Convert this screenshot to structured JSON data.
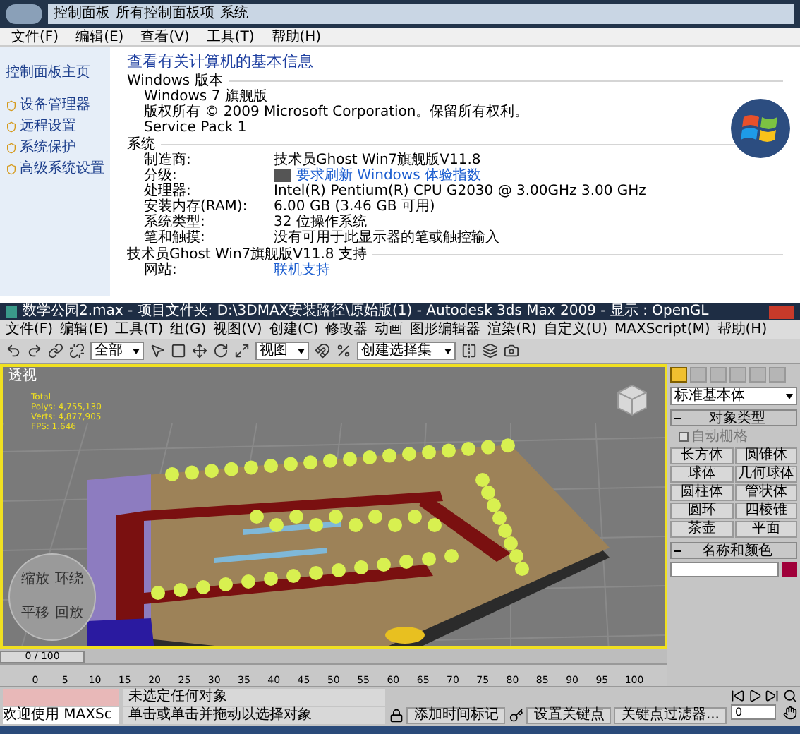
{
  "system_window": {
    "breadcrumb": [
      "控制面板",
      "所有控制面板项",
      "系统"
    ],
    "menu": [
      "文件(F)",
      "编辑(E)",
      "查看(V)",
      "工具(T)",
      "帮助(H)"
    ],
    "sidebar": [
      {
        "label": "控制面板主页",
        "kind": "home"
      },
      {
        "label": "设备管理器",
        "kind": "shield"
      },
      {
        "label": "远程设置",
        "kind": "shield"
      },
      {
        "label": "系统保护",
        "kind": "shield"
      },
      {
        "label": "高级系统设置",
        "kind": "shield"
      }
    ],
    "title": "查看有关计算机的基本信息",
    "sections": [
      {
        "heading": "Windows 版本",
        "rows": [
          {
            "value": "Windows 7 旗舰版",
            "kind": "text"
          },
          {
            "value": "版权所有 © 2009 Microsoft Corporation。保留所有权利。",
            "kind": "text"
          },
          {
            "value": "Service Pack 1",
            "kind": "text"
          }
        ]
      },
      {
        "heading": "系统",
        "rows": [
          {
            "label": "制造商:",
            "value": "技术员Ghost Win7旗舰版V11.8",
            "kind": "text"
          },
          {
            "label": "分级:",
            "value": "要求刷新 Windows 体验指数",
            "kind": "rating"
          },
          {
            "label": "处理器:",
            "value": "Intel(R) Pentium(R) CPU G2030 @ 3.00GHz   3.00 GHz",
            "kind": "text"
          },
          {
            "label": "安装内存(RAM):",
            "value": "6.00 GB (3.46 GB 可用)",
            "kind": "text"
          },
          {
            "label": "系统类型:",
            "value": "32 位操作系统",
            "kind": "text"
          },
          {
            "label": "笔和触摸:",
            "value": "没有可用于此显示器的笔或触控输入",
            "kind": "text"
          }
        ]
      },
      {
        "heading": "技术员Ghost Win7旗舰版V11.8 支持",
        "rows": [
          {
            "label": "网站:",
            "value": "联机支持",
            "kind": "link"
          }
        ]
      }
    ]
  },
  "max_window": {
    "title": "数学公园2.max - 项目文件夹: D:\\3DMAX安装路径\\原始版(1) - Autodesk 3ds Max 2009 - 显示 : OpenGL",
    "menu": [
      "文件(F)",
      "编辑(E)",
      "工具(T)",
      "组(G)",
      "视图(V)",
      "创建(C)",
      "修改器",
      "动画",
      "图形编辑器",
      "渲染(R)",
      "自定义(U)",
      "MAXScript(M)",
      "帮助(H)"
    ],
    "toolbar": {
      "selection_filter": "全部",
      "reference_coords": "视图",
      "selection_set": "创建选择集"
    },
    "viewport": {
      "label": "透视",
      "stats": [
        "Total",
        "Polys: 4,755,130",
        "Verts: 4,877,905",
        "FPS: 1.646"
      ],
      "wheel_labels": [
        "缩放",
        "环绕",
        "平移",
        "回放"
      ]
    },
    "command_panel": {
      "tabs": [
        {
          "selected": true
        },
        {
          "selected": false
        },
        {
          "selected": false
        },
        {
          "selected": false
        },
        {
          "selected": false
        },
        {
          "selected": false
        }
      ],
      "category": "标准基本体",
      "object_type": {
        "title": "对象类型",
        "expanded": true,
        "autogrid": {
          "label": "自动栅格",
          "checked": false
        },
        "buttons": [
          "长方体",
          "圆锥体",
          "球体",
          "几何球体",
          "圆柱体",
          "管状体",
          "圆环",
          "四棱锥",
          "茶壶",
          "平面"
        ]
      },
      "name_color": {
        "title": "名称和颜色",
        "expanded": true,
        "color": "#a0003a"
      }
    },
    "time_slider": {
      "reading": "0 / 100",
      "level": 0
    },
    "timeline_ticks": [
      "0",
      "5",
      "10",
      "15",
      "20",
      "25",
      "30",
      "35",
      "40",
      "45",
      "50",
      "55",
      "60",
      "65",
      "70",
      "75",
      "80",
      "85",
      "90",
      "95",
      "100"
    ],
    "status": {
      "script_field": "欢迎使用 MAXSc",
      "selection": "未选定任何对象",
      "prompt": "单击或单击并拖动以选择对象",
      "add_time_tag": "添加时间标记",
      "set_key": "设置关键点",
      "key_filters": "关键点过滤器...",
      "frame": "0"
    }
  }
}
